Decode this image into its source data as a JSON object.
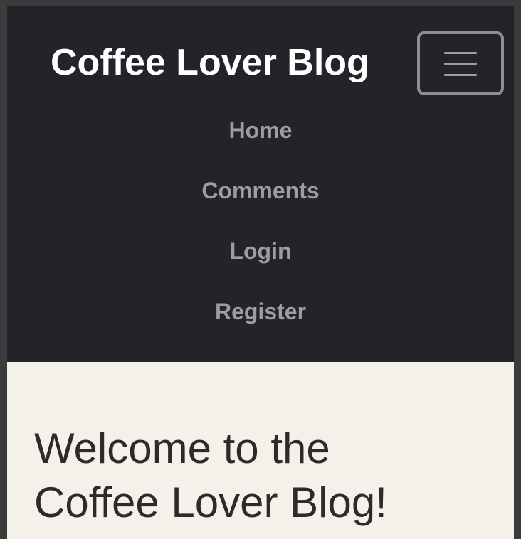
{
  "navbar": {
    "brand": "Coffee Lover Blog",
    "toggle_icon": "hamburger-menu-icon",
    "items": [
      {
        "label": "Home"
      },
      {
        "label": "Comments"
      },
      {
        "label": "Login"
      },
      {
        "label": "Register"
      }
    ]
  },
  "main": {
    "heading_line1": "Welcome to the",
    "heading_line2": "Coffee Lover Blog!"
  },
  "colors": {
    "navbar_bg": "#222429",
    "page_bg": "#f4f1eb",
    "nav_link": "#9c9d9f",
    "brand_text": "#ffffff",
    "heading_text": "#2e2b27"
  }
}
